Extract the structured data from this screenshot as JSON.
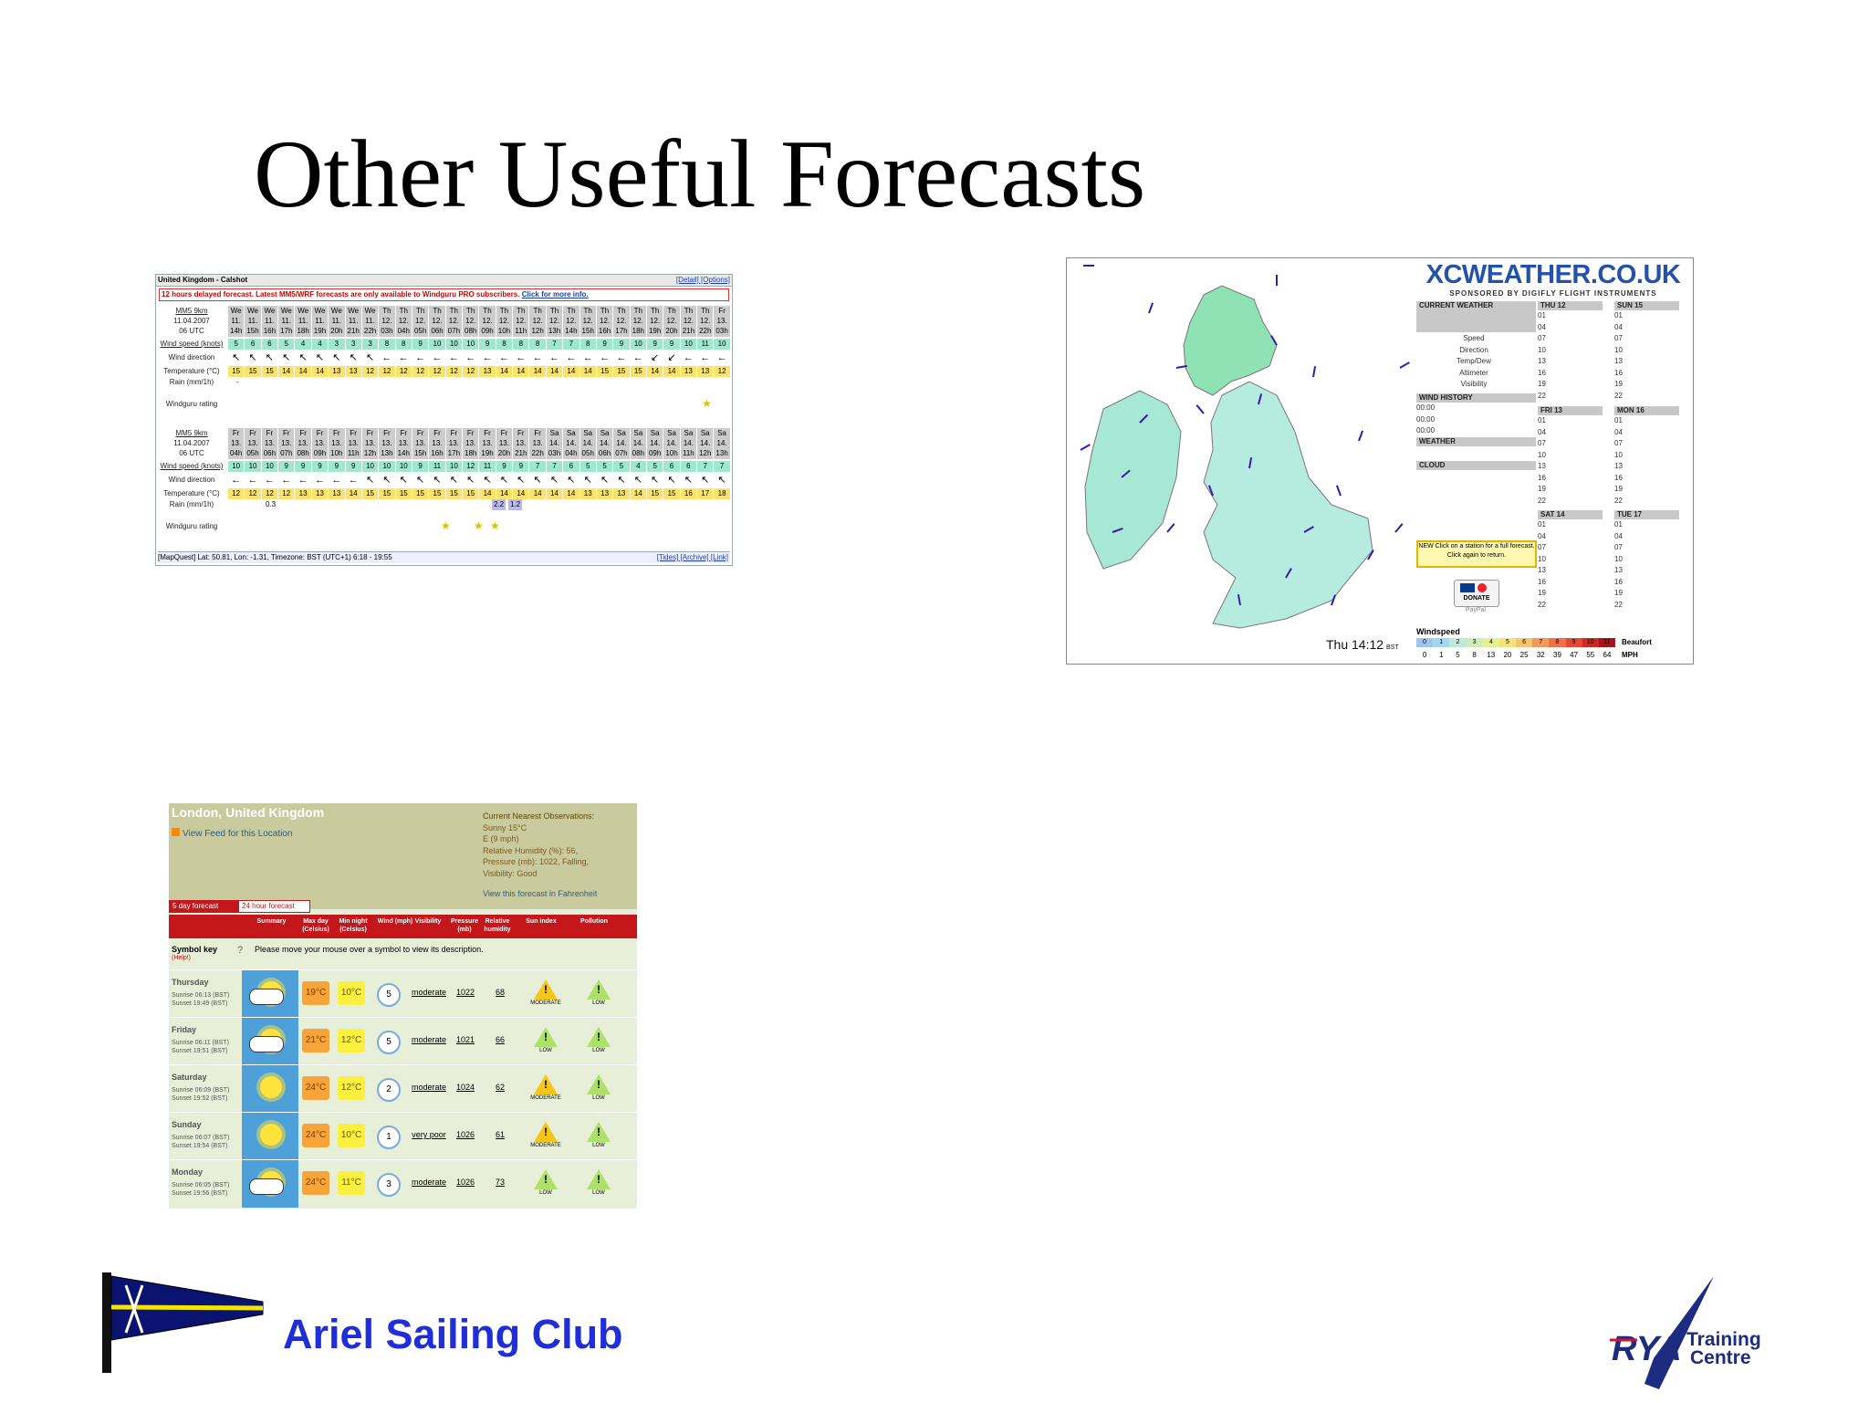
{
  "slide": {
    "title": "Other Useful Forecasts",
    "club_name": "Ariel Sailing Club",
    "rya_logo_text": "RYA",
    "rya_training": "Training",
    "rya_centre": "Centre"
  },
  "windguru": {
    "location": "United Kingdom - Calshot",
    "header_links": "[Detail] [Options]",
    "warning": "12 hours delayed forecast. Latest MM5/WRF forecasts are only available to Windguru PRO subscribers.",
    "warning_link": "Click for more info.",
    "model": "MM5 9km",
    "labels": {
      "wind_speed": "Wind speed (knots)",
      "wind_direction": "Wind direction",
      "temperature": "Temperature (°C)",
      "rain": "Rain (mm/1h)",
      "rating": "Windguru rating"
    },
    "block1": {
      "date": "11.04.2007",
      "utc": "06 UTC",
      "days": [
        "We",
        "We",
        "We",
        "We",
        "We",
        "We",
        "We",
        "We",
        "We",
        "Th",
        "Th",
        "Th",
        "Th",
        "Th",
        "Th",
        "Th",
        "Th",
        "Th",
        "Th",
        "Th",
        "Th",
        "Th",
        "Th",
        "Th",
        "Th",
        "Th",
        "Th",
        "Th",
        "Th",
        "Fr"
      ],
      "dates": [
        "11.",
        "11.",
        "11.",
        "11.",
        "11.",
        "11.",
        "11.",
        "11.",
        "11.",
        "12.",
        "12.",
        "12.",
        "12.",
        "12.",
        "12.",
        "12.",
        "12.",
        "12.",
        "12.",
        "12.",
        "12.",
        "12.",
        "12.",
        "12.",
        "12.",
        "12.",
        "12.",
        "12.",
        "12.",
        "13."
      ],
      "hours": [
        "14h",
        "15h",
        "16h",
        "17h",
        "18h",
        "19h",
        "20h",
        "21h",
        "22h",
        "03h",
        "04h",
        "05h",
        "06h",
        "07h",
        "08h",
        "09h",
        "10h",
        "11h",
        "12h",
        "13h",
        "14h",
        "15h",
        "16h",
        "17h",
        "18h",
        "19h",
        "20h",
        "21h",
        "22h",
        "03h"
      ],
      "wind": [
        "5",
        "6",
        "6",
        "5",
        "4",
        "4",
        "3",
        "3",
        "3",
        "8",
        "8",
        "9",
        "10",
        "10",
        "10",
        "9",
        "8",
        "8",
        "8",
        "7",
        "7",
        "8",
        "9",
        "9",
        "10",
        "9",
        "9",
        "10",
        "11",
        "10"
      ],
      "dir": [
        "↖",
        "↖",
        "↖",
        "↖",
        "↖",
        "↖",
        "↖",
        "↖",
        "↖",
        "←",
        "←",
        "←",
        "←",
        "←",
        "←",
        "←",
        "←",
        "←",
        "←",
        "←",
        "←",
        "←",
        "←",
        "←",
        "←",
        "↙",
        "↙",
        "←",
        "←",
        "←"
      ],
      "temp": [
        "15",
        "15",
        "15",
        "14",
        "14",
        "14",
        "13",
        "13",
        "12",
        "12",
        "12",
        "12",
        "12",
        "12",
        "12",
        "13",
        "14",
        "14",
        "14",
        "14",
        "14",
        "14",
        "15",
        "15",
        "15",
        "14",
        "14",
        "13",
        "13",
        "12"
      ],
      "rain_value": "-"
    },
    "block2": {
      "date": "11.04.2007",
      "utc": "06 UTC",
      "days": [
        "Fr",
        "Fr",
        "Fr",
        "Fr",
        "Fr",
        "Fr",
        "Fr",
        "Fr",
        "Fr",
        "Fr",
        "Fr",
        "Fr",
        "Fr",
        "Fr",
        "Fr",
        "Fr",
        "Fr",
        "Fr",
        "Fr",
        "Sa",
        "Sa",
        "Sa",
        "Sa",
        "Sa",
        "Sa",
        "Sa",
        "Sa",
        "Sa",
        "Sa",
        "Sa"
      ],
      "dates": [
        "13.",
        "13.",
        "13.",
        "13.",
        "13.",
        "13.",
        "13.",
        "13.",
        "13.",
        "13.",
        "13.",
        "13.",
        "13.",
        "13.",
        "13.",
        "13.",
        "13.",
        "13.",
        "13.",
        "14.",
        "14.",
        "14.",
        "14.",
        "14.",
        "14.",
        "14.",
        "14.",
        "14.",
        "14.",
        "14."
      ],
      "hours": [
        "04h",
        "05h",
        "06h",
        "07h",
        "08h",
        "09h",
        "10h",
        "11h",
        "12h",
        "13h",
        "14h",
        "15h",
        "16h",
        "17h",
        "18h",
        "19h",
        "20h",
        "21h",
        "22h",
        "03h",
        "04h",
        "05h",
        "06h",
        "07h",
        "08h",
        "09h",
        "10h",
        "11h",
        "12h",
        "13h"
      ],
      "wind": [
        "10",
        "10",
        "10",
        "9",
        "9",
        "9",
        "9",
        "9",
        "10",
        "10",
        "10",
        "9",
        "11",
        "10",
        "12",
        "11",
        "9",
        "9",
        "7",
        "7",
        "6",
        "5",
        "5",
        "5",
        "4",
        "5",
        "6",
        "6",
        "7",
        "7"
      ],
      "dir": [
        "←",
        "←",
        "←",
        "←",
        "←",
        "←",
        "←",
        "←",
        "↖",
        "↖",
        "↖",
        "↖",
        "↖",
        "↖",
        "↖",
        "↖",
        "↖",
        "↖",
        "↖",
        "↖",
        "↖",
        "↖",
        "↖",
        "↖",
        "↖",
        "↖",
        "↖",
        "↖",
        "↖",
        "↖"
      ],
      "temp": [
        "12",
        "12",
        "12",
        "12",
        "13",
        "13",
        "13",
        "14",
        "15",
        "15",
        "15",
        "15",
        "15",
        "15",
        "15",
        "14",
        "14",
        "14",
        "14",
        "14",
        "14",
        "13",
        "13",
        "13",
        "14",
        "15",
        "15",
        "16",
        "17",
        "18"
      ],
      "rain_values": [
        "0.3",
        "2.2",
        "1.2"
      ]
    },
    "footer": "[MapQuest] Lat: 50.81, Lon: -1.31, Timezone: BST (UTC+1) 6:18 - 19:55",
    "footer_links": "[Tides] [Archive] [Link]"
  },
  "xcweather": {
    "logo": "XCWEATHER.CO.UK",
    "sponsor": "SPONSORED BY DIGIFLY FLIGHT INSTRUMENTS",
    "current_weather": "CURRENT WEATHER",
    "fields": [
      "Speed",
      "Direction",
      "Temp/Dew",
      "Altimeter",
      "Visibility"
    ],
    "wind_history": "WIND HISTORY",
    "wind_history_times": [
      "00:00",
      "00:00",
      "00:00"
    ],
    "weather": "WEATHER",
    "cloud": "CLOUD",
    "days": {
      "thu": "THU 12",
      "sun": "SUN 15",
      "fri": "FRI 13",
      "mon": "MON 16",
      "sat": "SAT 14",
      "tue": "TUE 17"
    },
    "hours": [
      "01",
      "04",
      "07",
      "10",
      "13",
      "16",
      "19",
      "22"
    ],
    "notice": "NEW Click on a station for a full forecast. Click again to return.",
    "donate": "DONATE",
    "paypal": "PayPal",
    "time": "Thu 14:12",
    "time_zone": "BST",
    "windspeed_title": "Windspeed",
    "beaufort_label": "Beaufort",
    "mph_label": "MPH",
    "beaufort": [
      "0",
      "1",
      "2",
      "3",
      "4",
      "5",
      "6",
      "7",
      "8",
      "9",
      "10",
      "11"
    ],
    "mph": [
      "0",
      "1",
      "5",
      "8",
      "13",
      "20",
      "25",
      "32",
      "39",
      "47",
      "55",
      "64"
    ],
    "scale_colors": [
      "#9fc4f0",
      "#9fd8f0",
      "#bfe8d8",
      "#cdeeb4",
      "#e6f28c",
      "#f4e27a",
      "#f6c46e",
      "#f29a5a",
      "#ee7046",
      "#e24a34",
      "#cc2a22",
      "#a8141a"
    ]
  },
  "bbc": {
    "location": "London, United Kingdom",
    "feed": "View Feed for this Location",
    "obs_title": "Current Nearest Observations:",
    "obs_lines": [
      "Sunny 15°C",
      "E (9 mph)",
      "Relative Humidity (%): 56,",
      "Pressure (mb): 1022, Falling,",
      "Visibility: Good"
    ],
    "fahrenheit": "View this forecast in Fahrenheit",
    "tab_5day": "5 day forecast",
    "tab_24h": "24 hour forecast",
    "columns": [
      "Summary",
      "Max day (Celsius)",
      "Min night (Celsius)",
      "Wind (mph)",
      "Visibility",
      "Pressure (mb)",
      "Relative humidity",
      "Sun index",
      "Pollution"
    ],
    "symbol_key": "Symbol key",
    "help": "(Help!)",
    "symbol_hint": "Please move your mouse over a symbol to view its description.",
    "rows": [
      {
        "day": "Thursday",
        "sunrise": "Sunrise 06:13 (BST)",
        "sunset": "Sunset 19:49 (BST)",
        "max": "19°C",
        "min": "10°C",
        "wind": "5",
        "vis": "moderate",
        "pres": "1022",
        "hum": "68",
        "sun": "MODERATE",
        "poll": "LOW",
        "sym": "sun-cloud-icon"
      },
      {
        "day": "Friday",
        "sunrise": "Sunrise 06:11 (BST)",
        "sunset": "Sunset 19:51 (BST)",
        "max": "21°C",
        "min": "12°C",
        "wind": "5",
        "vis": "moderate",
        "pres": "1021",
        "hum": "66",
        "sun": "LOW",
        "poll": "LOW",
        "sym": "sun-cloud-icon"
      },
      {
        "day": "Saturday",
        "sunrise": "Sunrise 06:09 (BST)",
        "sunset": "Sunset 19:52 (BST)",
        "max": "24°C",
        "min": "12°C",
        "wind": "2",
        "vis": "moderate",
        "pres": "1024",
        "hum": "62",
        "sun": "MODERATE",
        "poll": "LOW",
        "sym": "sun-icon"
      },
      {
        "day": "Sunday",
        "sunrise": "Sunrise 06:07 (BST)",
        "sunset": "Sunset 19:54 (BST)",
        "max": "24°C",
        "min": "10°C",
        "wind": "1",
        "vis": "very poor",
        "pres": "1026",
        "hum": "61",
        "sun": "MODERATE",
        "poll": "LOW",
        "sym": "sun-icon"
      },
      {
        "day": "Monday",
        "sunrise": "Sunrise 06:05 (BST)",
        "sunset": "Sunset 19:56 (BST)",
        "max": "24°C",
        "min": "11°C",
        "wind": "3",
        "vis": "moderate",
        "pres": "1026",
        "hum": "73",
        "sun": "LOW",
        "poll": "LOW",
        "sym": "sun-cloud-icon"
      }
    ]
  }
}
